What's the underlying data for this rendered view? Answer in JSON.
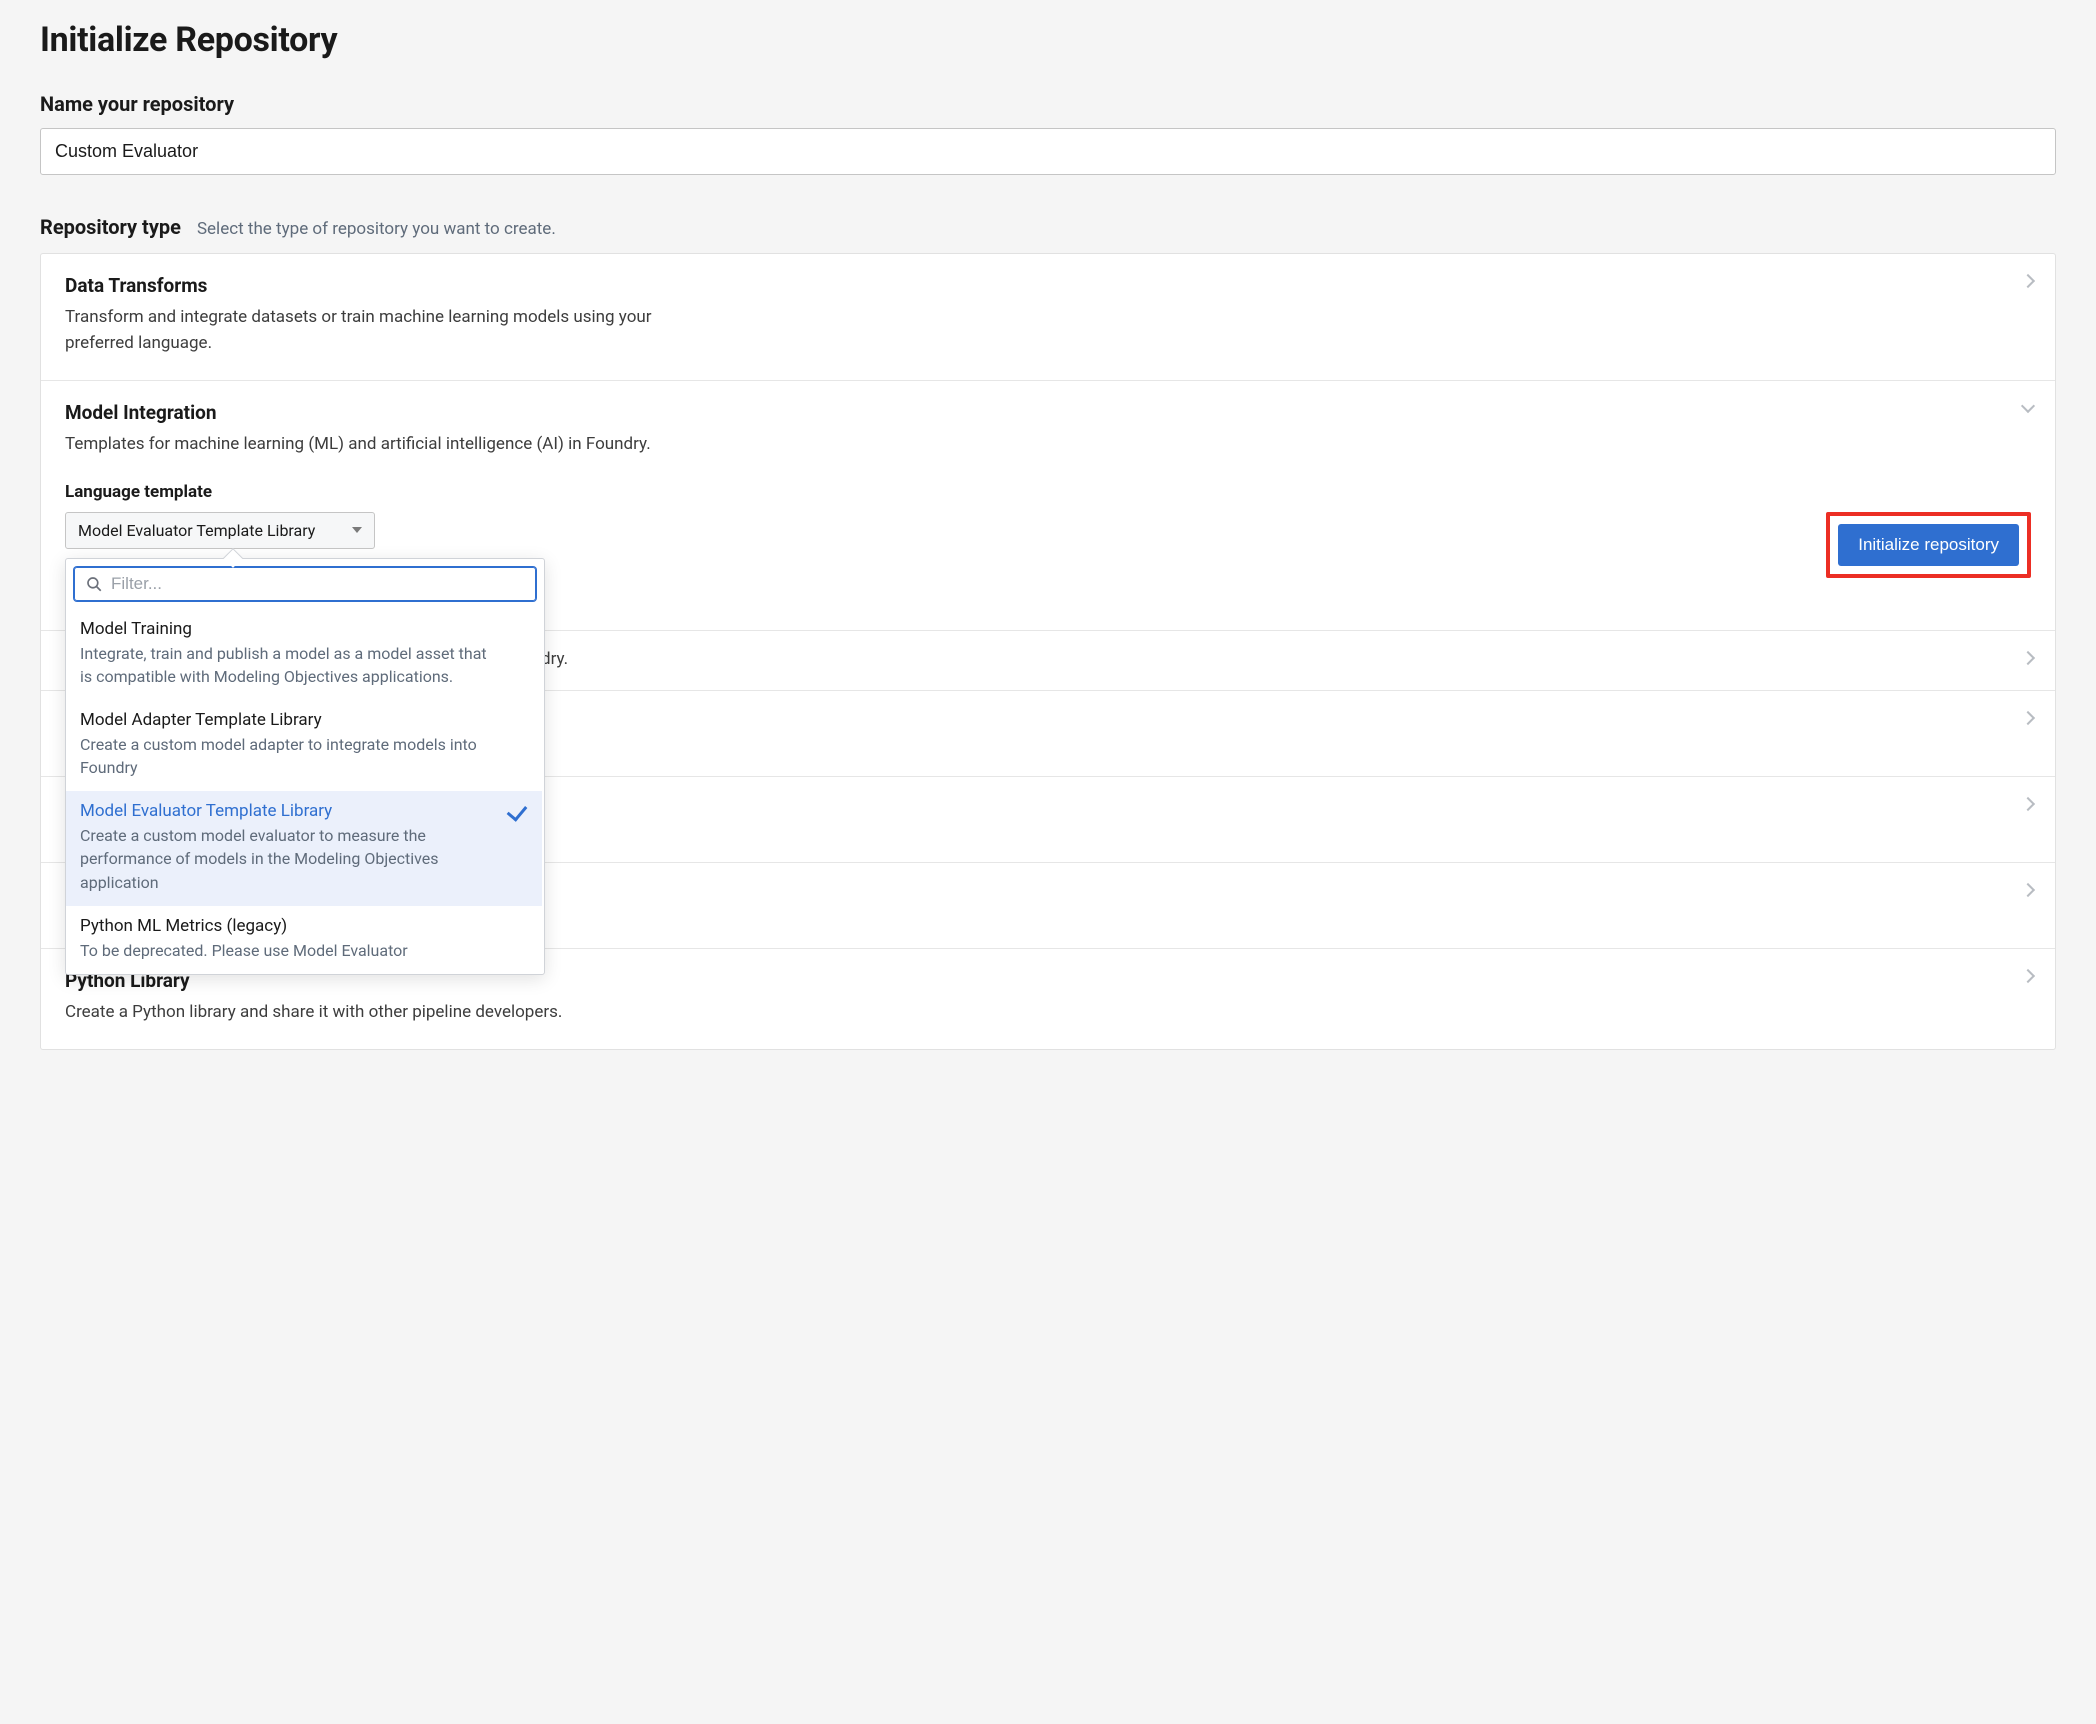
{
  "page": {
    "title": "Initialize Repository"
  },
  "name_field": {
    "label": "Name your repository",
    "value": "Custom Evaluator"
  },
  "type_section": {
    "label": "Repository type",
    "hint": "Select the type of repository you want to create."
  },
  "types": {
    "data_transforms": {
      "title": "Data Transforms",
      "desc": "Transform and integrate datasets or train machine learning models using your preferred language."
    },
    "model_integration": {
      "title": "Model Integration",
      "desc": "Templates for machine learning (ML) and artificial intelligence (AI) in Foundry.",
      "language_template_label": "Language template",
      "selected_template": "Model Evaluator Template Library",
      "initialize_button": "Initialize repository",
      "visible_desc_fragment": "dry."
    },
    "python_library": {
      "title": "Python Library",
      "desc": "Create a Python library and share it with other pipeline developers."
    }
  },
  "dropdown": {
    "filter_placeholder": "Filter...",
    "items": [
      {
        "title": "Model Training",
        "desc": "Integrate, train and publish a model as a model asset that is compatible with Modeling Objectives applications.",
        "selected": false
      },
      {
        "title": "Model Adapter Template Library",
        "desc": "Create a custom model adapter to integrate models into Foundry",
        "selected": false
      },
      {
        "title": "Model Evaluator Template Library",
        "desc": "Create a custom model evaluator to measure the performance of models in the Modeling Objectives application",
        "selected": true
      },
      {
        "title": "Python ML Metrics (legacy)",
        "desc": "To be deprecated. Please use Model Evaluator",
        "selected": false
      }
    ]
  }
}
